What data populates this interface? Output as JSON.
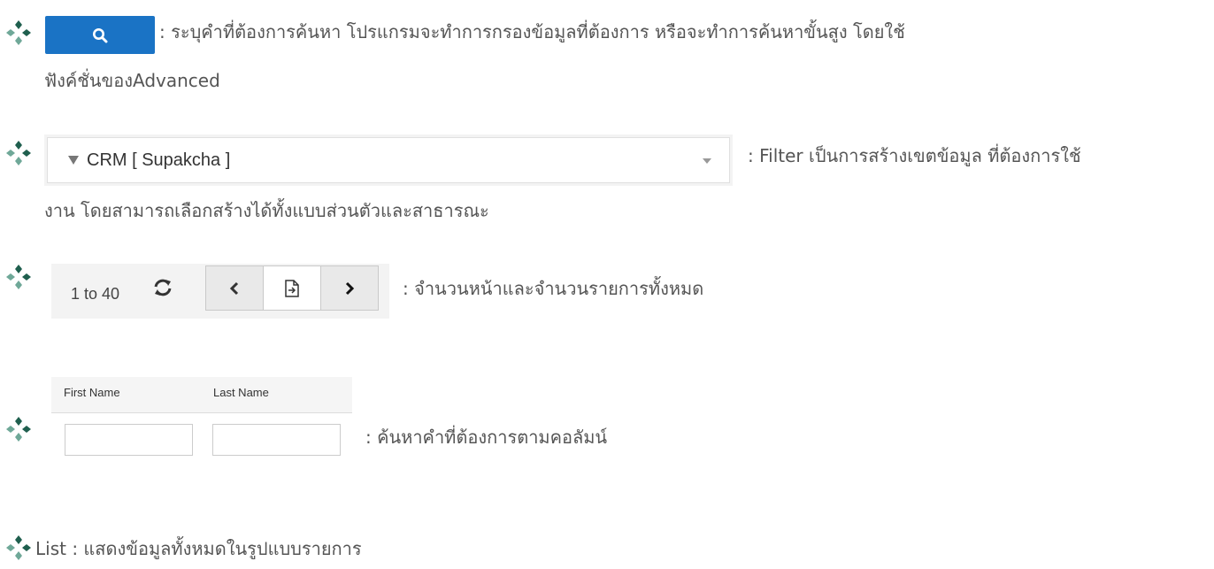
{
  "bullet_icon": "four-diamond-bullet",
  "colors": {
    "accent": "#1a73c5",
    "bullet_dark": "#1f5f4e",
    "bullet_light": "#6fa898",
    "text": "#555555"
  },
  "search": {
    "icon": "search-icon",
    "description_line1": ": ระบุคำที่ต้องการค้นหา โปรแกรมจะทำการกรองข้อมูลที่ต้องการ หรือจะทำการค้นหาขั้นสูง โดยใช้",
    "description_line2": "ฟังค์ชั่นของAdvanced"
  },
  "filter": {
    "icon": "filter-icon",
    "selected": "CRM [ Supakcha ]",
    "description_line1": ": Filter เป็นการสร้างเขตข้อมูล ที่ต้องการใช้",
    "description_line2": "งาน โดยสามารถเลือกสร้างได้ทั้งแบบส่วนตัวและสาธารณะ"
  },
  "pager": {
    "range": "1 to 40",
    "refresh_icon": "refresh-icon",
    "prev_icon": "chevron-left-icon",
    "export_icon": "export-icon",
    "next_icon": "chevron-right-icon",
    "description": ": จำนวนหน้าและจำนวนรายการทั้งหมด"
  },
  "column_search": {
    "first_name_label": "First Name",
    "last_name_label": "Last Name",
    "first_name_value": "",
    "last_name_value": "",
    "description": ":  ค้นหาคำที่ต้องการตามคอลัมน์"
  },
  "list": {
    "description": "List : แสดงข้อมูลทั้งหมดในรูปแบบรายการ"
  }
}
